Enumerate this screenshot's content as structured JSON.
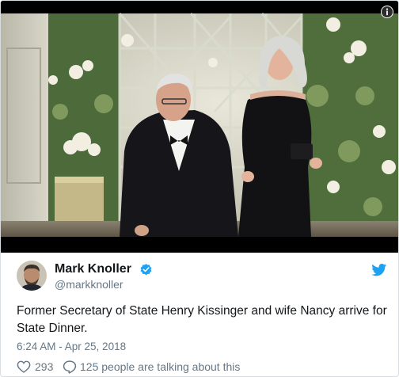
{
  "media": {
    "alt": "Henry Kissinger and Nancy Kissinger arriving at a state dinner in front of a floral trellis",
    "info_icon": "info-icon"
  },
  "author": {
    "display_name": "Mark Knoller",
    "handle": "@markknoller",
    "verified_icon": "verified-badge-icon",
    "platform_icon": "twitter-bird-icon"
  },
  "tweet": {
    "text": "Former Secretary of State Henry Kissinger and wife Nancy arrive for State Dinner.",
    "timestamp": "6:24 AM - Apr 25, 2018"
  },
  "actions": {
    "like_icon": "heart-icon",
    "like_count": "293",
    "reply_icon": "speech-bubble-icon",
    "talk_text": "125 people are talking about this"
  },
  "colors": {
    "twitter_blue": "#1da1f2",
    "text_primary": "#14171a",
    "text_secondary": "#657786",
    "border": "#d8dde2"
  }
}
